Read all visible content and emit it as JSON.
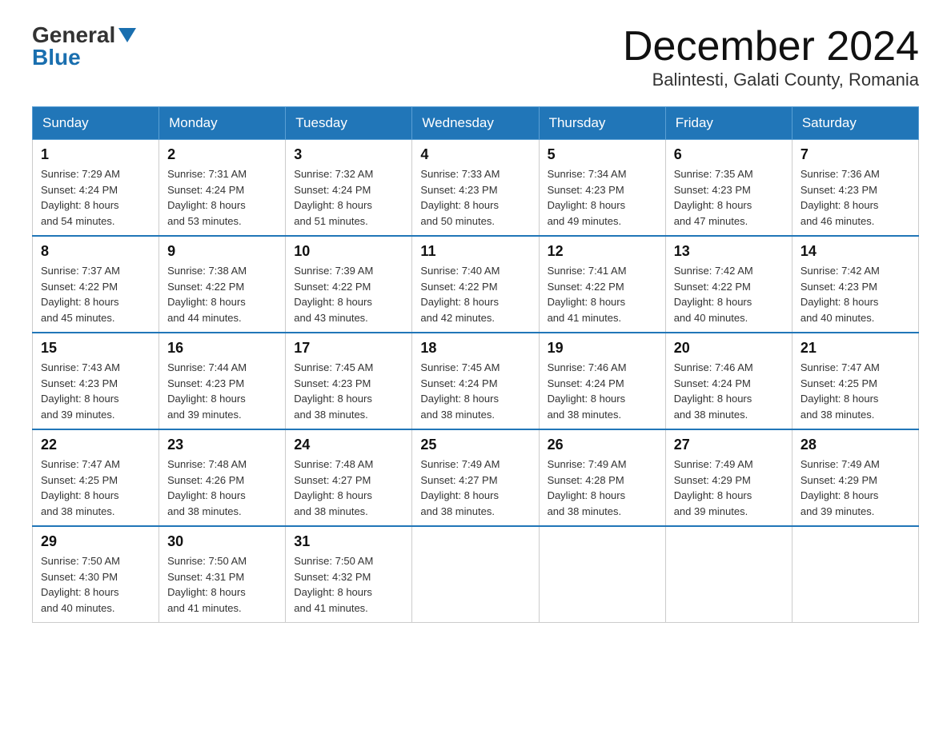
{
  "header": {
    "logo_general": "General",
    "logo_blue": "Blue",
    "month_title": "December 2024",
    "location": "Balintesti, Galati County, Romania"
  },
  "weekdays": [
    "Sunday",
    "Monday",
    "Tuesday",
    "Wednesday",
    "Thursday",
    "Friday",
    "Saturday"
  ],
  "weeks": [
    [
      {
        "day": "1",
        "sunrise": "7:29 AM",
        "sunset": "4:24 PM",
        "daylight": "8 hours and 54 minutes."
      },
      {
        "day": "2",
        "sunrise": "7:31 AM",
        "sunset": "4:24 PM",
        "daylight": "8 hours and 53 minutes."
      },
      {
        "day": "3",
        "sunrise": "7:32 AM",
        "sunset": "4:24 PM",
        "daylight": "8 hours and 51 minutes."
      },
      {
        "day": "4",
        "sunrise": "7:33 AM",
        "sunset": "4:23 PM",
        "daylight": "8 hours and 50 minutes."
      },
      {
        "day": "5",
        "sunrise": "7:34 AM",
        "sunset": "4:23 PM",
        "daylight": "8 hours and 49 minutes."
      },
      {
        "day": "6",
        "sunrise": "7:35 AM",
        "sunset": "4:23 PM",
        "daylight": "8 hours and 47 minutes."
      },
      {
        "day": "7",
        "sunrise": "7:36 AM",
        "sunset": "4:23 PM",
        "daylight": "8 hours and 46 minutes."
      }
    ],
    [
      {
        "day": "8",
        "sunrise": "7:37 AM",
        "sunset": "4:22 PM",
        "daylight": "8 hours and 45 minutes."
      },
      {
        "day": "9",
        "sunrise": "7:38 AM",
        "sunset": "4:22 PM",
        "daylight": "8 hours and 44 minutes."
      },
      {
        "day": "10",
        "sunrise": "7:39 AM",
        "sunset": "4:22 PM",
        "daylight": "8 hours and 43 minutes."
      },
      {
        "day": "11",
        "sunrise": "7:40 AM",
        "sunset": "4:22 PM",
        "daylight": "8 hours and 42 minutes."
      },
      {
        "day": "12",
        "sunrise": "7:41 AM",
        "sunset": "4:22 PM",
        "daylight": "8 hours and 41 minutes."
      },
      {
        "day": "13",
        "sunrise": "7:42 AM",
        "sunset": "4:22 PM",
        "daylight": "8 hours and 40 minutes."
      },
      {
        "day": "14",
        "sunrise": "7:42 AM",
        "sunset": "4:23 PM",
        "daylight": "8 hours and 40 minutes."
      }
    ],
    [
      {
        "day": "15",
        "sunrise": "7:43 AM",
        "sunset": "4:23 PM",
        "daylight": "8 hours and 39 minutes."
      },
      {
        "day": "16",
        "sunrise": "7:44 AM",
        "sunset": "4:23 PM",
        "daylight": "8 hours and 39 minutes."
      },
      {
        "day": "17",
        "sunrise": "7:45 AM",
        "sunset": "4:23 PM",
        "daylight": "8 hours and 38 minutes."
      },
      {
        "day": "18",
        "sunrise": "7:45 AM",
        "sunset": "4:24 PM",
        "daylight": "8 hours and 38 minutes."
      },
      {
        "day": "19",
        "sunrise": "7:46 AM",
        "sunset": "4:24 PM",
        "daylight": "8 hours and 38 minutes."
      },
      {
        "day": "20",
        "sunrise": "7:46 AM",
        "sunset": "4:24 PM",
        "daylight": "8 hours and 38 minutes."
      },
      {
        "day": "21",
        "sunrise": "7:47 AM",
        "sunset": "4:25 PM",
        "daylight": "8 hours and 38 minutes."
      }
    ],
    [
      {
        "day": "22",
        "sunrise": "7:47 AM",
        "sunset": "4:25 PM",
        "daylight": "8 hours and 38 minutes."
      },
      {
        "day": "23",
        "sunrise": "7:48 AM",
        "sunset": "4:26 PM",
        "daylight": "8 hours and 38 minutes."
      },
      {
        "day": "24",
        "sunrise": "7:48 AM",
        "sunset": "4:27 PM",
        "daylight": "8 hours and 38 minutes."
      },
      {
        "day": "25",
        "sunrise": "7:49 AM",
        "sunset": "4:27 PM",
        "daylight": "8 hours and 38 minutes."
      },
      {
        "day": "26",
        "sunrise": "7:49 AM",
        "sunset": "4:28 PM",
        "daylight": "8 hours and 38 minutes."
      },
      {
        "day": "27",
        "sunrise": "7:49 AM",
        "sunset": "4:29 PM",
        "daylight": "8 hours and 39 minutes."
      },
      {
        "day": "28",
        "sunrise": "7:49 AM",
        "sunset": "4:29 PM",
        "daylight": "8 hours and 39 minutes."
      }
    ],
    [
      {
        "day": "29",
        "sunrise": "7:50 AM",
        "sunset": "4:30 PM",
        "daylight": "8 hours and 40 minutes."
      },
      {
        "day": "30",
        "sunrise": "7:50 AM",
        "sunset": "4:31 PM",
        "daylight": "8 hours and 41 minutes."
      },
      {
        "day": "31",
        "sunrise": "7:50 AM",
        "sunset": "4:32 PM",
        "daylight": "8 hours and 41 minutes."
      },
      null,
      null,
      null,
      null
    ]
  ],
  "labels": {
    "sunrise": "Sunrise:",
    "sunset": "Sunset:",
    "daylight": "Daylight:"
  }
}
